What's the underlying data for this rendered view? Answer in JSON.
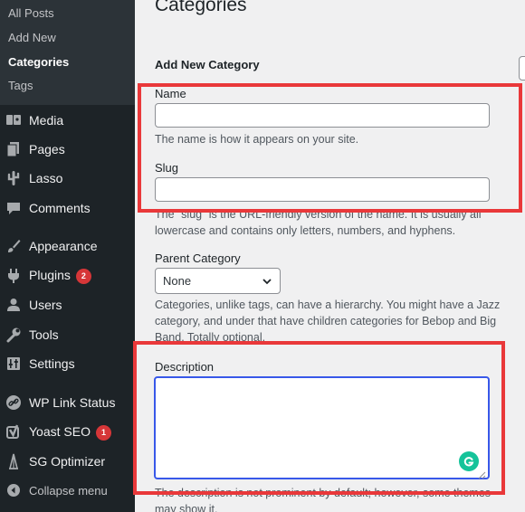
{
  "sidebar": {
    "submenu": [
      {
        "label": "All Posts",
        "current": false
      },
      {
        "label": "Add New",
        "current": false
      },
      {
        "label": "Categories",
        "current": true
      },
      {
        "label": "Tags",
        "current": false
      }
    ],
    "items": [
      {
        "label": "Media",
        "icon": "media-icon"
      },
      {
        "label": "Pages",
        "icon": "pages-icon"
      },
      {
        "label": "Lasso",
        "icon": "cactus-icon"
      },
      {
        "label": "Comments",
        "icon": "comments-icon"
      },
      {
        "label": "Appearance",
        "icon": "paintbrush-icon"
      },
      {
        "label": "Plugins",
        "icon": "plugins-icon",
        "badge": "2"
      },
      {
        "label": "Users",
        "icon": "users-icon"
      },
      {
        "label": "Tools",
        "icon": "wrench-icon"
      },
      {
        "label": "Settings",
        "icon": "settings-icon"
      },
      {
        "label": "WP Link Status",
        "icon": "link-icon"
      },
      {
        "label": "Yoast SEO",
        "icon": "yoast-icon",
        "badge": "1"
      },
      {
        "label": "SG Optimizer",
        "icon": "sg-optimizer-icon"
      }
    ],
    "collapse": {
      "label": "Collapse menu",
      "icon": "collapse-icon"
    }
  },
  "main": {
    "page_title": "Categories",
    "section_title": "Add New Category",
    "name": {
      "label": "Name",
      "value": "",
      "help": "The name is how it appears on your site."
    },
    "slug": {
      "label": "Slug",
      "value": "",
      "help": "The “slug” is the URL-friendly version of the name. It is usually all lowercase and contains only letters, numbers, and hyphens."
    },
    "parent": {
      "label": "Parent Category",
      "selected": "None",
      "help": "Categories, unlike tags, can have a hierarchy. You might have a Jazz category, and under that have children categories for Bebop and Big Band. Totally optional."
    },
    "description": {
      "label": "Description",
      "value": "",
      "help": "The description is not prominent by default; however, some themes may show it."
    }
  },
  "colors": {
    "sidebar_bg": "#1d2327",
    "submenu_bg": "#2c3338",
    "badge": "#d63638",
    "highlight": "#e9383a",
    "focus": "#3858e9",
    "grammarly": "#15c39a"
  }
}
